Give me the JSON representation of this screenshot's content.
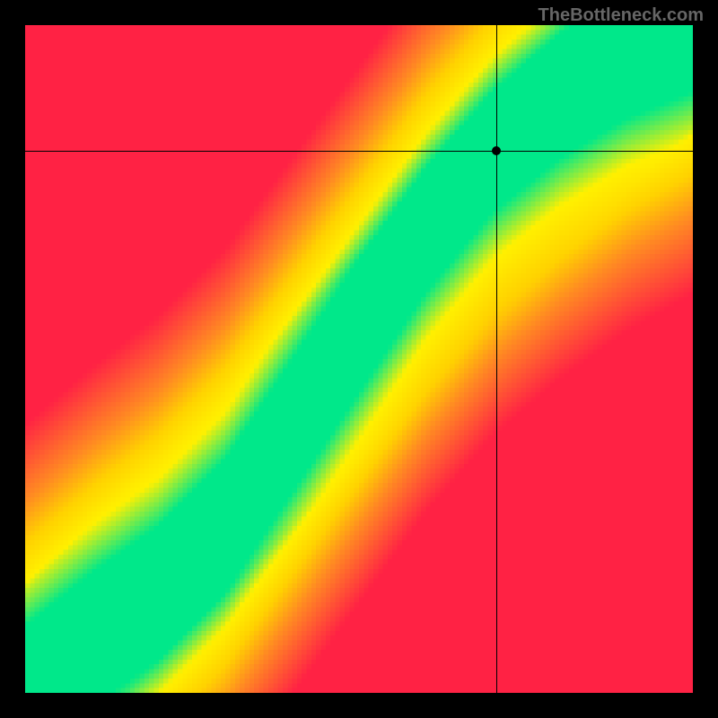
{
  "watermark": "TheBottleneck.com",
  "chart_data": {
    "type": "heatmap",
    "title": "",
    "xlabel": "",
    "ylabel": "",
    "xlim": [
      0,
      1
    ],
    "ylim": [
      0,
      1
    ],
    "colorscale": [
      {
        "value": 0.0,
        "color": "#ff2244"
      },
      {
        "value": 0.35,
        "color": "#ff8a22"
      },
      {
        "value": 0.55,
        "color": "#ffd200"
      },
      {
        "value": 0.72,
        "color": "#fff000"
      },
      {
        "value": 0.88,
        "color": "#00e88a"
      },
      {
        "value": 1.0,
        "color": "#00e88a"
      }
    ],
    "ridge": [
      {
        "x": 0.0,
        "y": 0.0
      },
      {
        "x": 0.1,
        "y": 0.08
      },
      {
        "x": 0.2,
        "y": 0.15
      },
      {
        "x": 0.3,
        "y": 0.25
      },
      {
        "x": 0.4,
        "y": 0.4
      },
      {
        "x": 0.5,
        "y": 0.55
      },
      {
        "x": 0.6,
        "y": 0.7
      },
      {
        "x": 0.7,
        "y": 0.82
      },
      {
        "x": 0.8,
        "y": 0.9
      },
      {
        "x": 0.9,
        "y": 0.96
      },
      {
        "x": 1.0,
        "y": 1.0
      }
    ],
    "ridge_width": 0.045,
    "marker": {
      "x": 0.705,
      "y": 0.812
    },
    "crosshair": {
      "x": 0.705,
      "y": 0.812
    },
    "grid_resolution": 140
  }
}
